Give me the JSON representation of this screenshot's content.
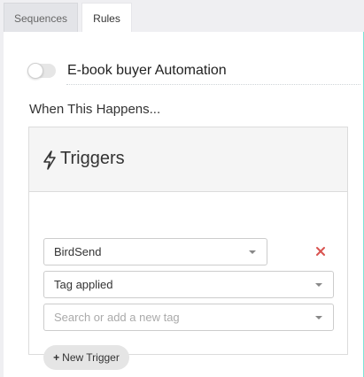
{
  "tabs": [
    {
      "label": "Sequences",
      "active": false
    },
    {
      "label": "Rules",
      "active": true
    }
  ],
  "rule": {
    "enabled": false,
    "name": "E-book buyer Automation"
  },
  "section": {
    "label": "When This Happens..."
  },
  "triggers_card": {
    "title": "Triggers",
    "icon": "lightning-bolt-icon",
    "source_select": {
      "value": "BirdSend"
    },
    "event_select": {
      "value": "Tag applied"
    },
    "tag_select": {
      "placeholder": "Search or add a new tag"
    },
    "delete_icon": "close-icon",
    "new_trigger_plus": "+",
    "new_trigger_label": "New Trigger"
  },
  "colors": {
    "accent_border": "#7be4d6",
    "delete_red": "#d9534f"
  }
}
